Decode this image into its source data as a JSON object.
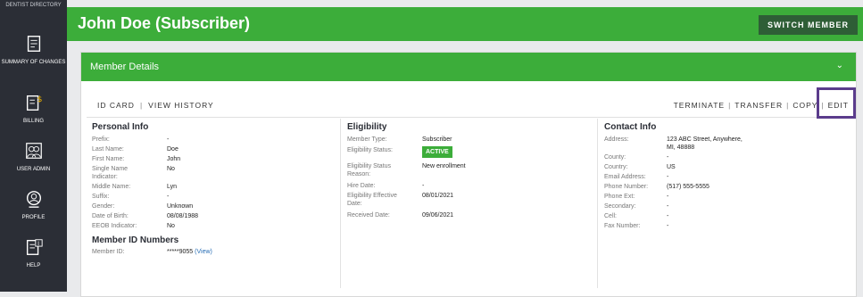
{
  "sidebar": {
    "top_label": "DENTIST DIRECTORY",
    "items": [
      {
        "label": "SUMMARY OF CHANGES",
        "icon": "document-list-icon"
      },
      {
        "label": "BILLING",
        "icon": "document-dollar-icon"
      },
      {
        "label": "USER ADMIN",
        "icon": "users-icon"
      },
      {
        "label": "PROFILE",
        "icon": "user-profile-icon"
      },
      {
        "label": "HELP",
        "icon": "help-document-icon"
      }
    ]
  },
  "header": {
    "title": "John Doe (Subscriber)",
    "switch_label": "SWITCH MEMBER"
  },
  "card": {
    "title": "Member Details",
    "left_actions": [
      "ID CARD",
      "VIEW HISTORY"
    ],
    "right_actions": [
      "TERMINATE",
      "TRANSFER",
      "COPY",
      "EDIT"
    ]
  },
  "personal": {
    "title": "Personal Info",
    "rows": [
      {
        "label": "Prefix:",
        "value": "-"
      },
      {
        "label": "Last Name:",
        "value": "Doe"
      },
      {
        "label": "First Name:",
        "value": "John"
      },
      {
        "label": "Single Name Indicator:",
        "value": "No"
      },
      {
        "label": "Middle Name:",
        "value": "Lyn"
      },
      {
        "label": "Suffix:",
        "value": "-"
      },
      {
        "label": "Gender:",
        "value": "Unknown"
      },
      {
        "label": "Date of Birth:",
        "value": "08/08/1988"
      },
      {
        "label": "EEOB Indicator:",
        "value": "No"
      }
    ],
    "member_ids_title": "Member ID Numbers",
    "member_id_label": "Member ID:",
    "member_id_value": "*****9055",
    "member_id_link": "(View)"
  },
  "eligibility": {
    "title": "Eligibility",
    "rows": [
      {
        "label": "Member Type:",
        "value": "Subscriber"
      },
      {
        "label": "Eligibility Status:",
        "value": "ACTIVE"
      },
      {
        "label": "Eligibility Status Reason:",
        "value": "New enrollment"
      },
      {
        "label": "Hire Date:",
        "value": "-"
      },
      {
        "label": "Eligibility Effective Date:",
        "value": "08/01/2021"
      },
      {
        "label": "Received Date:",
        "value": "09/06/2021"
      }
    ]
  },
  "contact": {
    "title": "Contact Info",
    "rows": [
      {
        "label": "Address:",
        "value": "123 ABC Street, Anywhere, MI, 48888"
      },
      {
        "label": "County:",
        "value": "-"
      },
      {
        "label": "Country:",
        "value": "US"
      },
      {
        "label": "Email Address:",
        "value": "-"
      },
      {
        "label": "Phone Number:",
        "value": "(517) 555-5555"
      },
      {
        "label": "Phone Ext:",
        "value": "-"
      },
      {
        "label": "Secondary:",
        "value": "-"
      },
      {
        "label": "Cell:",
        "value": "-"
      },
      {
        "label": "Fax Number:",
        "value": "-"
      }
    ]
  },
  "colors": {
    "brand_green": "#3cad3a",
    "sidebar": "#2b2e36",
    "switch_button": "#2e5e36",
    "highlight": "#5b3c8c"
  }
}
